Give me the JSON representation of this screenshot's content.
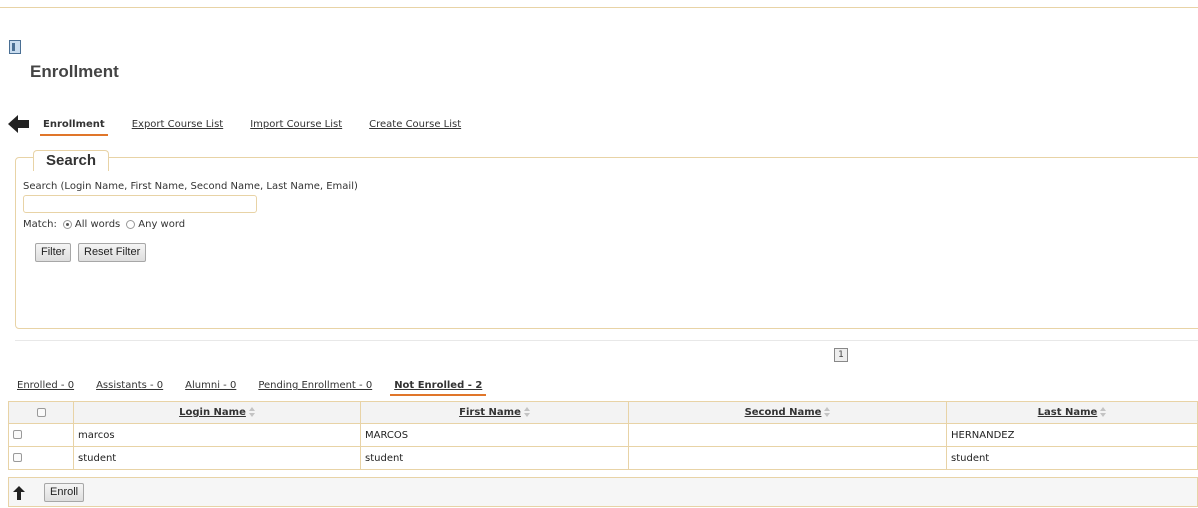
{
  "header": {
    "title": "Enrollment"
  },
  "tabs": [
    {
      "label": "Enrollment",
      "active": true
    },
    {
      "label": "Export Course List",
      "active": false
    },
    {
      "label": "Import Course List",
      "active": false
    },
    {
      "label": "Create Course List",
      "active": false
    }
  ],
  "search": {
    "legend": "Search",
    "label": "Search (Login Name, First Name, Second Name, Last Name, Email)",
    "value": "",
    "match_label": "Match:",
    "match_options": [
      {
        "label": "All words",
        "selected": true
      },
      {
        "label": "Any word",
        "selected": false
      }
    ],
    "filter_button": "Filter",
    "reset_button": "Reset Filter"
  },
  "pagination": {
    "current_page": "1"
  },
  "subtabs": [
    {
      "label": "Enrolled - 0",
      "active": false
    },
    {
      "label": "Assistants - 0",
      "active": false
    },
    {
      "label": "Alumni - 0",
      "active": false
    },
    {
      "label": "Pending Enrollment - 0",
      "active": false
    },
    {
      "label": "Not Enrolled - 2",
      "active": true
    }
  ],
  "table": {
    "columns": [
      "Login Name",
      "First Name",
      "Second Name",
      "Last Name"
    ],
    "rows": [
      {
        "login": "marcos",
        "first": "MARCOS",
        "second": "",
        "last": "HERNANDEZ"
      },
      {
        "login": "student",
        "first": "student",
        "second": "",
        "last": "student"
      }
    ]
  },
  "footer": {
    "enroll_button": "Enroll"
  },
  "colors": {
    "accent": "#e0762a",
    "border": "#e8d3a6"
  },
  "icons": {
    "back": "arrow-left-icon",
    "up": "arrow-up-icon",
    "app": "course-icon"
  }
}
